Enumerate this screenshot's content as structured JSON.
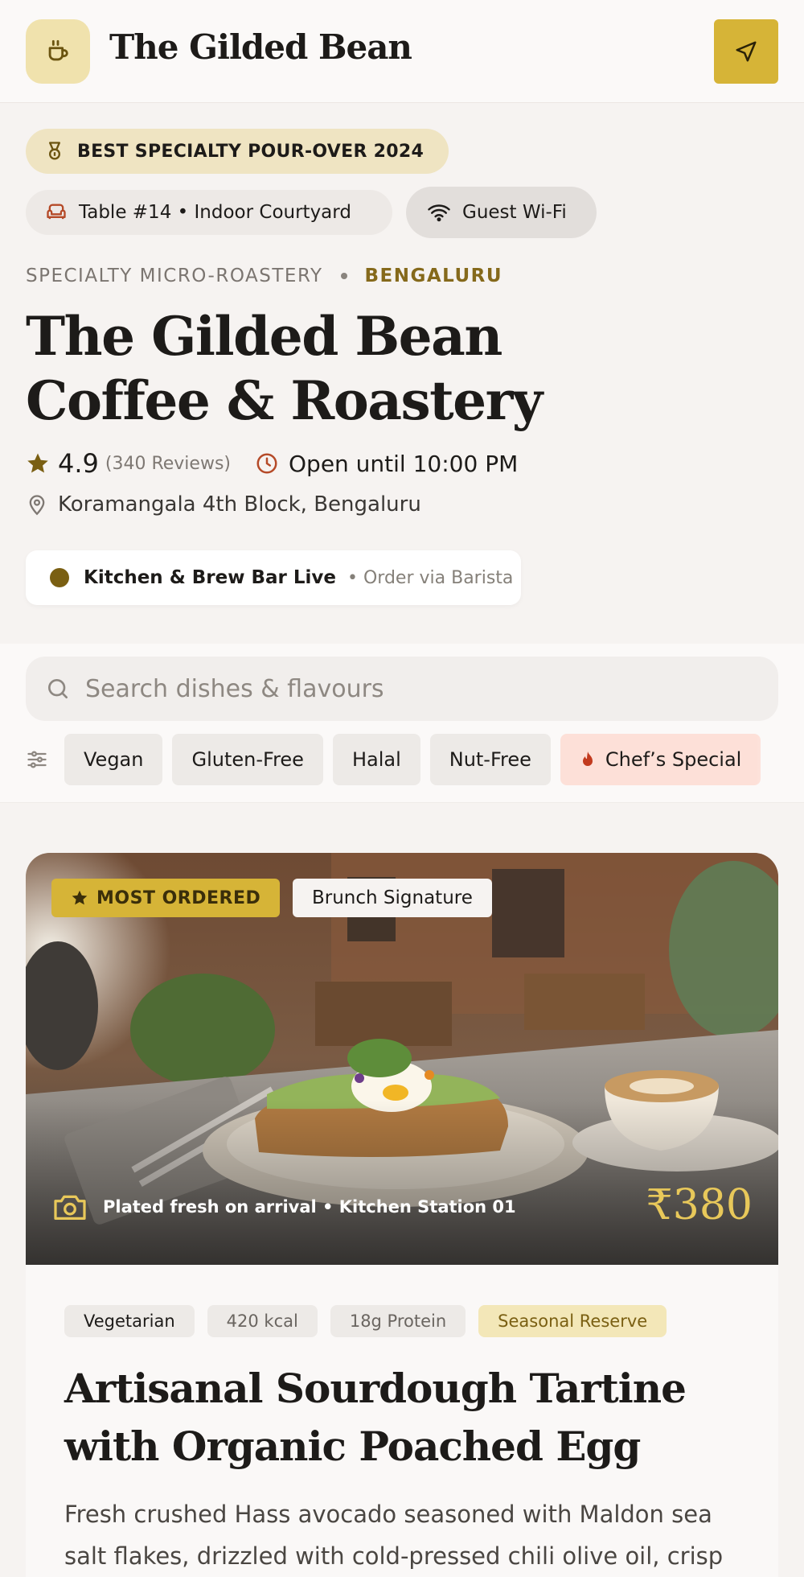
{
  "header": {
    "brand": "The Gilded Bean",
    "logo_icon": "coffee-cup-icon",
    "nav_icon": "navigation-arrow-icon",
    "accent": "#d6b437"
  },
  "badges": {
    "award": "BEST SPECIALTY POUR-OVER 2024",
    "table": "Table #14 • Indoor Courtyard",
    "wifi": "Guest Wi-Fi"
  },
  "venue": {
    "category": "SPECIALTY MICRO-ROASTERY",
    "city": "BENGALURU",
    "name": "The Gilded Bean Coffee & Roastery",
    "rating": "4.9",
    "reviews": "(340 Reviews)",
    "hours": "Open until 10:00 PM",
    "address": "Koramangala 4th Block, Bengaluru",
    "live_status": "Kitchen & Brew Bar Live",
    "live_note": "• Order via Barista"
  },
  "search": {
    "placeholder": "Search dishes & flavours"
  },
  "filters": [
    "Vegan",
    "Gluten-Free",
    "Halal",
    "Nut-Free",
    "Chef’s Special"
  ],
  "dish": {
    "badge_primary": "MOST ORDERED",
    "badge_secondary": "Brunch Signature",
    "caption": "Plated fresh on arrival • Kitchen Station 01",
    "price": "₹380",
    "tags": [
      "Vegetarian",
      "420 kcal",
      "18g Protein",
      "Seasonal Reserve"
    ],
    "title": "Artisanal Sourdough Tartine with Organic Poached Egg",
    "description": "Fresh crushed Hass avocado seasoned with Maldon sea salt flakes, drizzled with cold-pressed chili olive oil, crisp"
  }
}
